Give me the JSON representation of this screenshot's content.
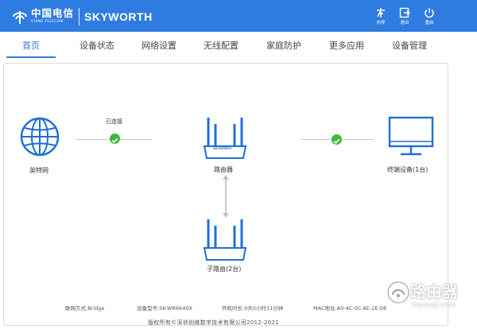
{
  "header": {
    "logo_cn": "中国电信",
    "logo_en": "CHINA TELECOM",
    "brand": "SKYWORTH",
    "buttons": [
      {
        "label": "向导",
        "icon": "wizard-icon"
      },
      {
        "label": "退出",
        "icon": "logout-icon"
      },
      {
        "label": "重启",
        "icon": "power-icon"
      }
    ]
  },
  "nav": {
    "tabs": [
      {
        "label": "首页"
      },
      {
        "label": "设备状态"
      },
      {
        "label": "网络设置"
      },
      {
        "label": "无线配置"
      },
      {
        "label": "家庭防护"
      },
      {
        "label": "更多应用"
      },
      {
        "label": "设备管理"
      }
    ],
    "active_index": 0
  },
  "topology": {
    "internet_label": "英特网",
    "connection_status": "已连接",
    "router_label": "路由器",
    "router_badge": "SKYWORTH",
    "terminal_label": "终端设备(1台)",
    "subrouter_label": "子路由(2台)"
  },
  "footer": {
    "connection_type": "联网方式:Bridge",
    "device_model": "设备型号:SK-WR6640X",
    "uptime": "开机时长:0天0小时11分钟",
    "mac": "MAC地址:A0-4C-0C-8E-2E-08",
    "copyright": "版权所有©深圳创维数字技术有限公司2012-2021"
  },
  "watermark": {
    "title": "路由器",
    "url": "luyouqi.com"
  },
  "colors": {
    "header_bg": "#2f7ce0",
    "accent": "#2f7ce0",
    "icon_blue": "#1f6fd6",
    "status_green": "#3fb83f"
  }
}
